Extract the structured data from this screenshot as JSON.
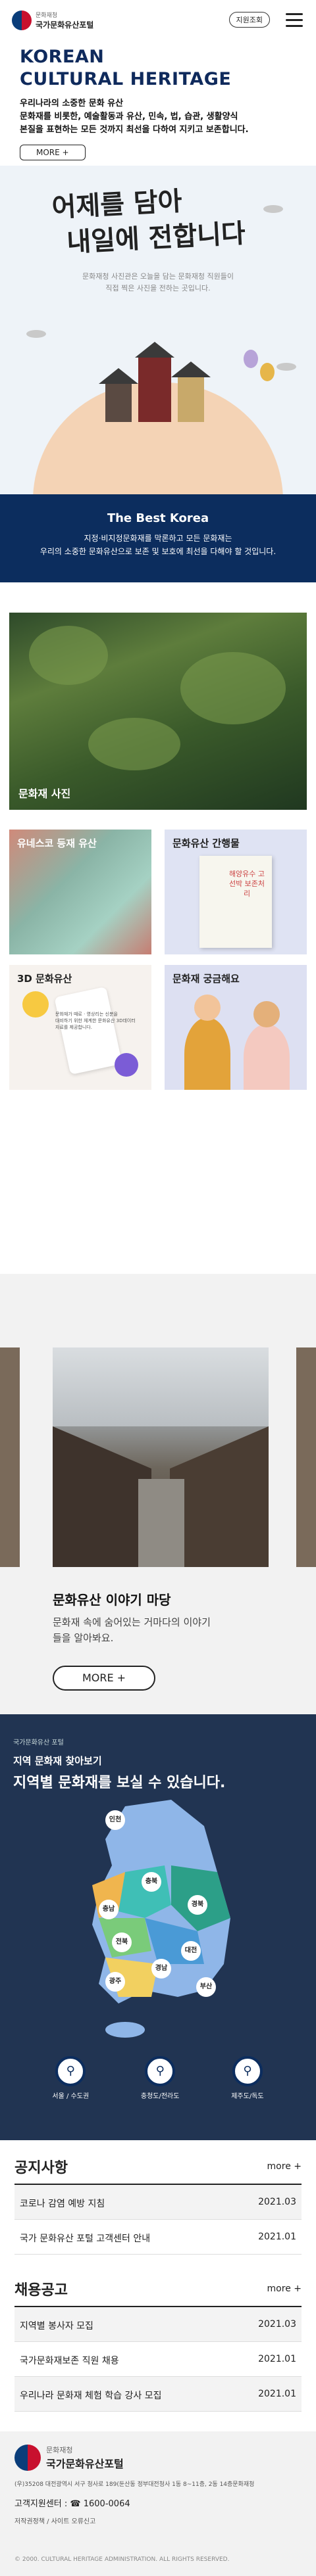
{
  "header": {
    "logo_small": "문화재청",
    "logo_name": "국가문화유산포털",
    "menu_button": "지원조회"
  },
  "intro": {
    "title_line1": "KOREAN",
    "title_line2": "CULTURAL HERITAGE",
    "desc_line1": "우리나라의 소중한 문화 유산",
    "desc_line2": "문화재를 비롯한, 예술활동과 유산, 민속, 법, 습관, 생활양식",
    "desc_line3": "본질을 표현하는 모든 것까지 최선을 다하여 지키고 보존합니다.",
    "more_label": "MORE +"
  },
  "hero": {
    "calligraphy_line1": "어제를 담아",
    "calligraphy_line2": "내일에 전합니다",
    "sub_line1": "문화재청 사진관은 오늘을 담는 문화재청 직원들이",
    "sub_line2": "직접 찍은 사진을 전하는 곳입니다."
  },
  "best": {
    "title": "The Best Korea",
    "line1": "지정·비지정문화재를 막론하고 모든 문화재는",
    "line2": "우리의 소중한 문화유산으로 보존 및 보호에 최선을 다해야 할 것입니다."
  },
  "gallery": {
    "big_label": "문화재 사진",
    "cards": [
      {
        "label": "유네스코 등재 유산"
      },
      {
        "label": "문화유산 간행물"
      },
      {
        "label": "3D 문화유산"
      },
      {
        "label": "문화재 궁금해요"
      }
    ],
    "book_title": "해양유수 고선박 보존처리",
    "card3_desc_line1": "문화재가 때로 · 영상리는 신분을",
    "card3_desc_line2": "대비하기 위한 체계한 문화유산 3D데이터",
    "card3_desc_line3": "자료를 제공합니다."
  },
  "story": {
    "title": "문화유산 이야기 마당",
    "desc_line1": "문화재 속에 숨어있는 거마다의 이야기",
    "desc_line2": "들을 알아봐요.",
    "more_label": "MORE +"
  },
  "map": {
    "tag": "국가문화유산 포털",
    "tag2": "지역 문화재 찾아보기",
    "headline": "지역별 문화재를 보실 수 있습니다.",
    "regions": [
      "인천",
      "충북",
      "경북",
      "충남",
      "전북",
      "대전",
      "경남",
      "광주",
      "부산"
    ],
    "icons": [
      {
        "label": "서울 / 수도권"
      },
      {
        "label": "충청도/전라도"
      },
      {
        "label": "제주도/독도"
      }
    ]
  },
  "notices": {
    "title": "공지사항",
    "more": "more +",
    "items": [
      {
        "text": "코로나 감염 예방 지침",
        "date": "2021.03"
      },
      {
        "text": "국가 문화유산 포털 고객센터 안내",
        "date": "2021.01"
      }
    ]
  },
  "jobs": {
    "title": "채용공고",
    "more": "more +",
    "items": [
      {
        "text": "지역별 봉사자 모집",
        "date": "2021.03"
      },
      {
        "text": "국가문화재보존 직원 채용",
        "date": "2021.01"
      },
      {
        "text": "우리나라 문화재 체험 학습 강사 모집",
        "date": "2021.01"
      }
    ]
  },
  "footer": {
    "logo_small": "문화재청",
    "logo_name": "국가문화유산포털",
    "address": "(우)35208 대전광역시 서구 청사로 189(둔산동 정부대전청사 1동 8~11층, 2동 14층문화재청",
    "tel_label": "고객지원센터 :",
    "tel": "☎ 1600-0064",
    "links": "저작권정책  /  사이트 오류신고",
    "copyright": "© 2000. CULTURAL HERITAGE ADMINISTRATION. ALL RIGHTS RESERVED."
  }
}
